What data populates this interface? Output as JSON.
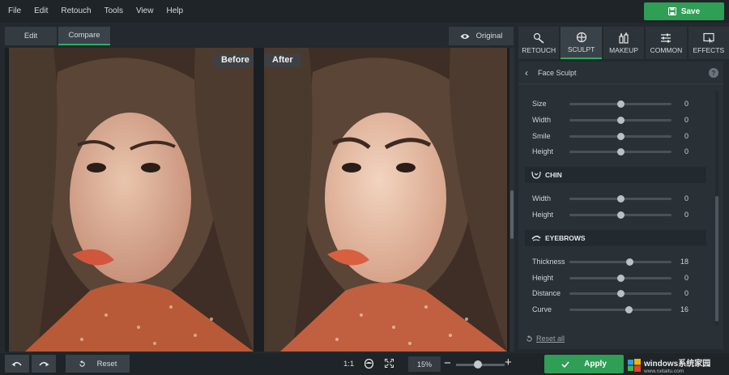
{
  "menu": [
    "File",
    "Edit",
    "Retouch",
    "Tools",
    "View",
    "Help"
  ],
  "save_label": "Save",
  "view_tabs": [
    {
      "label": "Edit",
      "active": false
    },
    {
      "label": "Compare",
      "active": true
    }
  ],
  "original_label": "Original",
  "canvas": {
    "before_label": "Before",
    "after_label": "After"
  },
  "tool_tabs": [
    {
      "label": "RETOUCH",
      "icon": "retouch-icon",
      "active": false
    },
    {
      "label": "SCULPT",
      "icon": "sculpt-icon",
      "active": true
    },
    {
      "label": "MAKEUP",
      "icon": "makeup-icon",
      "active": false
    },
    {
      "label": "COMMON",
      "icon": "sliders-icon",
      "active": false
    },
    {
      "label": "EFFECTS",
      "icon": "effects-icon",
      "active": false
    }
  ],
  "panel": {
    "title": "Face Sculpt",
    "help": "?",
    "sliders_top": [
      {
        "label": "Size",
        "value": "0",
        "level": 0.5
      },
      {
        "label": "Width",
        "value": "0",
        "level": 0.5
      },
      {
        "label": "Smile",
        "value": "0",
        "level": 0.5
      },
      {
        "label": "Height",
        "value": "0",
        "level": 0.5
      }
    ],
    "chin": {
      "title": "CHIN",
      "sliders": [
        {
          "label": "Width",
          "value": "0",
          "level": 0.5
        },
        {
          "label": "Height",
          "value": "0",
          "level": 0.5
        }
      ]
    },
    "eyebrows": {
      "title": "EYEBROWS",
      "sliders": [
        {
          "label": "Thickness",
          "value": "18",
          "level": 0.59
        },
        {
          "label": "Height",
          "value": "0",
          "level": 0.5
        },
        {
          "label": "Distance",
          "value": "0",
          "level": 0.5
        },
        {
          "label": "Curve",
          "value": "16",
          "level": 0.58
        }
      ]
    },
    "reset_all": "Reset all"
  },
  "bottom": {
    "reset_label": "Reset",
    "ratio_label": "1:1",
    "zoom_value": "15%",
    "zoom_minus": "−",
    "zoom_plus": "+",
    "apply_label": "Apply"
  },
  "watermark": {
    "text": "windows系统家园",
    "sub": "www.ruitaitu.com"
  },
  "colors": {
    "accent": "#2e9f55",
    "background": "#23292e",
    "panel": "#2a3136"
  }
}
